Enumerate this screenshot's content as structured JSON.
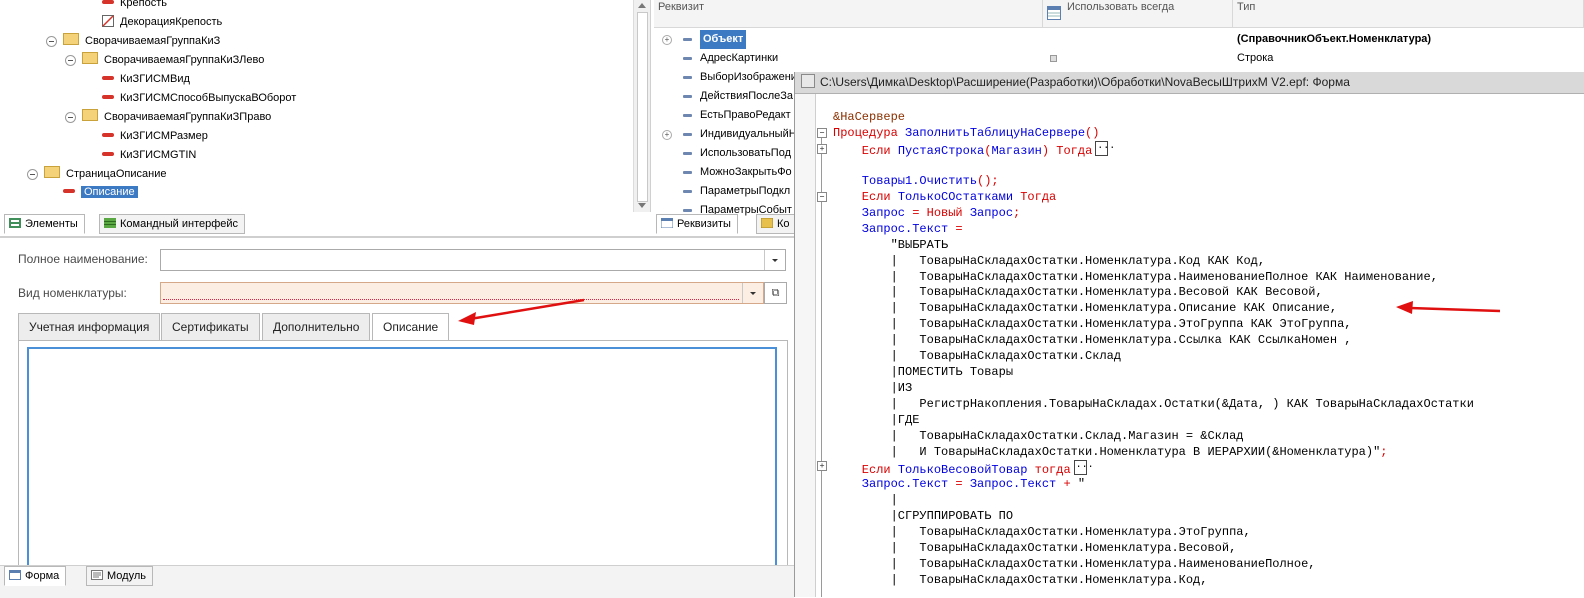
{
  "tree": {
    "items": [
      {
        "label": "Крепость",
        "type": "field"
      },
      {
        "label": "ДекорацияКрепость",
        "type": "decoration"
      },
      {
        "label": "СворачиваемаяГруппаКиЗ",
        "type": "group"
      },
      {
        "label": "СворачиваемаяГруппаКиЗЛево",
        "type": "group"
      },
      {
        "label": "КиЗГИСМВид",
        "type": "field"
      },
      {
        "label": "КиЗГИСМСпособВыпускаВОборот",
        "type": "field"
      },
      {
        "label": "СворачиваемаяГруппаКиЗПраво",
        "type": "group"
      },
      {
        "label": "КиЗГИСМРазмер",
        "type": "field"
      },
      {
        "label": "КиЗГИСМGTIN",
        "type": "field"
      },
      {
        "label": "СтраницаОписание",
        "type": "page"
      },
      {
        "label": "Описание",
        "type": "field",
        "selected": true
      }
    ],
    "tabs": [
      {
        "label": "Элементы",
        "active": true
      },
      {
        "label": "Командный интерфейс",
        "active": false
      }
    ]
  },
  "attributes": {
    "headers": {
      "name": "Реквизит",
      "use_always": "Использовать всегда",
      "type": "Тип"
    },
    "rows": [
      {
        "name": "Объект",
        "type": "(СправочникОбъект.Номенклатура)",
        "selected": true,
        "expandable": true
      },
      {
        "name": "АдресКартинки",
        "type": "Строка"
      },
      {
        "name": "ВыборИзображени"
      },
      {
        "name": "ДействияПослеЗа"
      },
      {
        "name": "ЕстьПравоРедакт"
      },
      {
        "name": "ИндивидуальныйН",
        "expandable": true
      },
      {
        "name": "ИспользоватьПод"
      },
      {
        "name": "МожноЗакрытьФо"
      },
      {
        "name": "ПараметрыПодкл"
      },
      {
        "name": "ПараметрыСобыт"
      }
    ],
    "tabs": [
      {
        "label": "Реквизиты",
        "active": true
      },
      {
        "label": "Ко",
        "active": false
      }
    ]
  },
  "form": {
    "full_name_label": "Полное наименование:",
    "full_name_value": "",
    "kind_label": "Вид номенклатуры:",
    "kind_value": "",
    "tabs": [
      {
        "label": "Учетная информация",
        "active": false
      },
      {
        "label": "Сертификаты",
        "active": false
      },
      {
        "label": "Дополнительно",
        "active": false
      },
      {
        "label": "Описание",
        "active": true
      }
    ],
    "bottom_tabs": [
      {
        "label": "Форма",
        "active": true
      },
      {
        "label": "Модуль",
        "active": false
      }
    ]
  },
  "code_window": {
    "title": "C:\\Users\\Димка\\Desktop\\Расширение(Разработки)\\Обработки\\NovaВесыШтрихМ V2.epf: Форма",
    "lines": [
      [
        {
          "t": "&НаСервере",
          "c": "dir"
        }
      ],
      [
        {
          "t": "Процедура ",
          "c": "kw"
        },
        {
          "t": "ЗаполнитьТаблицуНаСервере",
          "c": "id"
        },
        {
          "t": "()",
          "c": "kw"
        }
      ],
      [
        {
          "t": "    Если ",
          "c": "kw"
        },
        {
          "t": "ПустаяСтрока",
          "c": "id"
        },
        {
          "t": "(",
          "c": "kw"
        },
        {
          "t": "Магазин",
          "c": "id"
        },
        {
          "t": ") Тогда",
          "c": "kw"
        }
      ],
      [
        {
          "t": "",
          "c": "tx"
        }
      ],
      [
        {
          "t": "    Товары1.Очистить",
          "c": "id"
        },
        {
          "t": "();",
          "c": "kw"
        }
      ],
      [
        {
          "t": "    Если ",
          "c": "kw"
        },
        {
          "t": "ТолькоСОстатками ",
          "c": "id"
        },
        {
          "t": "Тогда",
          "c": "kw"
        }
      ],
      [
        {
          "t": "    Запрос ",
          "c": "id"
        },
        {
          "t": "= Новый ",
          "c": "kw"
        },
        {
          "t": "Запрос",
          "c": "id"
        },
        {
          "t": ";",
          "c": "kw"
        }
      ],
      [
        {
          "t": "    Запрос.Текст ",
          "c": "id"
        },
        {
          "t": "=",
          "c": "kw"
        }
      ],
      [
        {
          "t": "        \"ВЫБРАТЬ",
          "c": "tx"
        }
      ],
      [
        {
          "t": "        |   ТоварыНаСкладахОстатки.Номенклатура.Код КАК Код,",
          "c": "tx"
        }
      ],
      [
        {
          "t": "        |   ТоварыНаСкладахОстатки.Номенклатура.НаименованиеПолное КАК Наименование,",
          "c": "tx"
        }
      ],
      [
        {
          "t": "        |   ТоварыНаСкладахОстатки.Номенклатура.Весовой КАК Весовой,",
          "c": "tx"
        }
      ],
      [
        {
          "t": "        |   ТоварыНаСкладахОстатки.Номенклатура.Описание КАК Описание,",
          "c": "tx"
        }
      ],
      [
        {
          "t": "        |   ТоварыНаСкладахОстатки.Номенклатура.ЭтоГруппа КАК ЭтоГруппа,",
          "c": "tx"
        }
      ],
      [
        {
          "t": "        |   ТоварыНаСкладахОстатки.Номенклатура.Ссылка КАК СсылкаНомен ,",
          "c": "tx"
        }
      ],
      [
        {
          "t": "        |   ТоварыНаСкладахОстатки.Склад",
          "c": "tx"
        }
      ],
      [
        {
          "t": "        |ПОМЕСТИТЬ Товары",
          "c": "tx"
        }
      ],
      [
        {
          "t": "        |ИЗ",
          "c": "tx"
        }
      ],
      [
        {
          "t": "        |   РегистрНакопления.ТоварыНаСкладах.Остатки(&Дата, ) КАК ТоварыНаСкладахОстатки",
          "c": "tx"
        }
      ],
      [
        {
          "t": "        |ГДЕ",
          "c": "tx"
        }
      ],
      [
        {
          "t": "        |   ТоварыНаСкладахОстатки.Склад.Магазин = &Склад",
          "c": "tx"
        }
      ],
      [
        {
          "t": "        |   И ТоварыНаСкладахОстатки.Номенклатура В ИЕРАРХИИ(&Номенклатура)\"",
          "c": "tx"
        },
        {
          "t": ";",
          "c": "kw"
        }
      ],
      [
        {
          "t": "    Если ",
          "c": "kw"
        },
        {
          "t": "ТолькоВесовойТовар ",
          "c": "id"
        },
        {
          "t": "тогда",
          "c": "kw"
        }
      ],
      [
        {
          "t": "    Запрос.Текст ",
          "c": "id"
        },
        {
          "t": "= ",
          "c": "kw"
        },
        {
          "t": "Запрос.Текст ",
          "c": "id"
        },
        {
          "t": "+ ",
          "c": "kw"
        },
        {
          "t": "\"",
          "c": "tx"
        }
      ],
      [
        {
          "t": "        |",
          "c": "tx"
        }
      ],
      [
        {
          "t": "        |СГРУППИРОВАТЬ ПО",
          "c": "tx"
        }
      ],
      [
        {
          "t": "        |   ТоварыНаСкладахОстатки.Номенклатура.ЭтоГруппа,",
          "c": "tx"
        }
      ],
      [
        {
          "t": "        |   ТоварыНаСкладахОстатки.Номенклатура.Весовой,",
          "c": "tx"
        }
      ],
      [
        {
          "t": "        |   ТоварыНаСкладахОстатки.Номенклатура.НаименованиеПолное,",
          "c": "tx"
        }
      ],
      [
        {
          "t": "        |   ТоварыНаСкладахОстатки.Номенклатура.Код,",
          "c": "tx"
        }
      ]
    ]
  },
  "colors": {
    "selection": "#3d7ac4",
    "keyword": "#d90000",
    "identifier": "#0000e0",
    "annotation_arrow": "#e01010"
  }
}
